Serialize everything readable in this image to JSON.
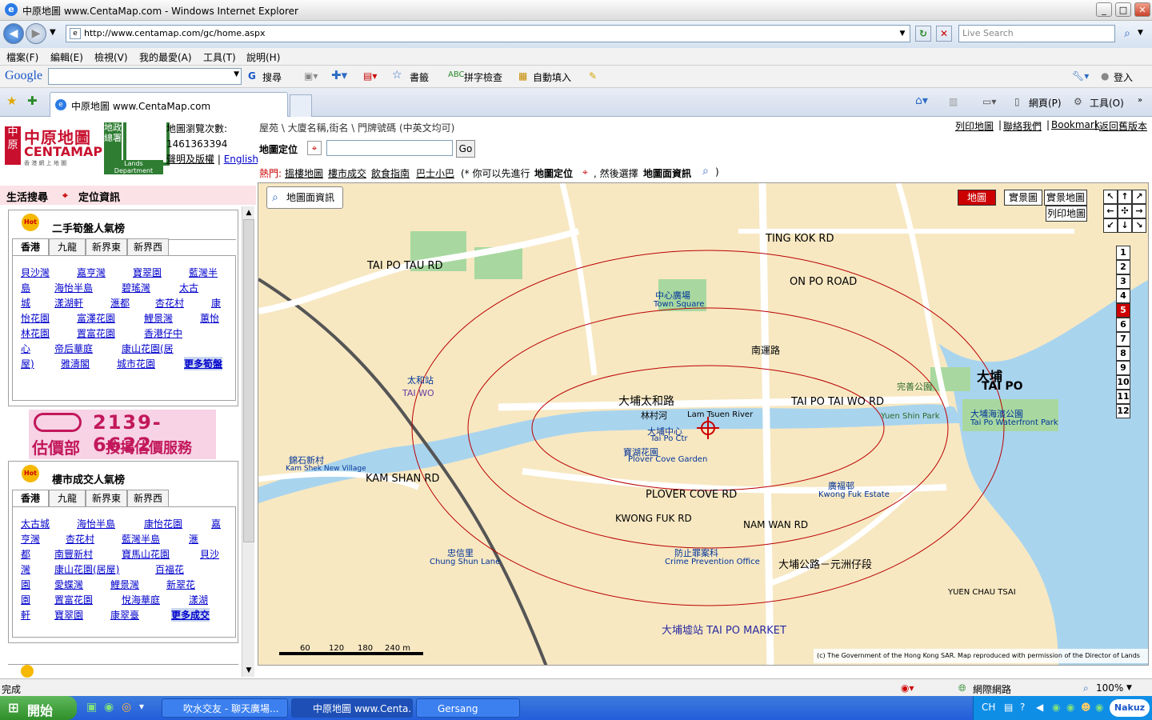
{
  "window": {
    "title": "中原地圖 www.CentaMap.com - Windows Internet Explorer",
    "icon": "ie-icon"
  },
  "addressbar": {
    "url": "http://www.centamap.com/gc/home.aspx",
    "search_placeholder": "Live Search"
  },
  "menu": [
    "檔案(F)",
    "編輯(E)",
    "檢視(V)",
    "我的最愛(A)",
    "工具(T)",
    "說明(H)"
  ],
  "google_toolbar": {
    "brand": "Google",
    "search_label": "搜尋",
    "bookmarks_label": "書籤",
    "spellcheck_label": "拼字檢查",
    "autofill_label": "自動填入",
    "signin_label": "登入"
  },
  "tab": {
    "title": "中原地圖 www.CentaMap.com",
    "page_menu": "網頁(P)",
    "tools_menu": "工具(O)"
  },
  "site": {
    "logo_cn_vertical": "中原",
    "logo_name": "中原地圖",
    "logo_en": "CENTAMAP",
    "logo_sub": "香 港 網 上 地 圖",
    "lands_dept_cn": "地政總署",
    "lands_dept_en": "Lands Department",
    "counter_label": "地圖瀏覽次數:",
    "counter_value": "1461363394",
    "disclaimer_link": "聲明及版權",
    "english_link": "English"
  },
  "left_header": {
    "tab1": "生活搜尋",
    "tab2": "定位資訊"
  },
  "section1": {
    "title": "二手筍盤人氣榜",
    "regions": [
      "香港",
      "九龍",
      "新界東",
      "新界西"
    ],
    "links": [
      "貝沙灣",
      "嘉亨灣",
      "寶翠園",
      "藍灣半",
      "島",
      "海怡半島",
      "碧瑤灣",
      "太古",
      "城",
      "漾湖軒",
      "滙都",
      "杏花村",
      "康",
      "怡花園",
      "富澤花園",
      "鯉景灣",
      "蕙怡",
      "林花園",
      "置富花園",
      "香港仔中",
      "心",
      "帝后華庭",
      "康山花園(居",
      "屋)",
      "雅濤閣",
      "城市花園"
    ],
    "more": "更多筍盤"
  },
  "banner": {
    "phone": "2139-6622",
    "dept": "估價部",
    "service": "按揭估價服務"
  },
  "section2": {
    "title": "樓市成交人氣榜",
    "regions": [
      "香港",
      "九龍",
      "新界東",
      "新界西"
    ],
    "links": [
      "太古城",
      "海怡半島",
      "康怡花園",
      "嘉",
      "亨灣",
      "杏花村",
      "藍灣半島",
      "滙",
      "都",
      "南豐新村",
      "寶馬山花園",
      "貝沙",
      "灣",
      "康山花園(居屋)",
      "百福花",
      "園",
      "愛蝶灣",
      "鯉景灣",
      "新翠花",
      "園",
      "置富花園",
      "悅海華庭",
      "漾湖",
      "軒",
      "寶翠園",
      "康翠臺"
    ],
    "more": "更多成交"
  },
  "map_header": {
    "hint": "屋苑 \\ 大廈名稱,街名 \\ 門牌號碼 (中英文均可)",
    "top_links": [
      "列印地圖",
      "聯絡我們",
      "Bookmark",
      "返回舊版本"
    ],
    "locate_label": "地圖定位",
    "go": "Go",
    "hot_label": "熱門:",
    "hot_links": [
      "搵樓地圖",
      "樓市成交",
      "飲食指南",
      "巴士小巴"
    ],
    "instruction_pre": "(* 你可以先進行",
    "instruction_locate": "地圖定位",
    "instruction_mid": ", 然後選擇",
    "instruction_info": "地圖面資訊",
    "instruction_post": ")"
  },
  "map": {
    "info_button": "地圖面資訊",
    "view_tabs": [
      "地圖",
      "實景圖",
      "實景地圖"
    ],
    "print_button": "列印地圖",
    "zoom_levels": [
      "1",
      "2",
      "3",
      "4",
      "5",
      "6",
      "7",
      "8",
      "9",
      "10",
      "11",
      "12"
    ],
    "zoom_selected": 5,
    "scale_labels": [
      "60",
      "120",
      "180",
      "240 m"
    ],
    "copyright": "(c) The Government of the Hong Kong SAR. Map reproduced with permission of the Director of Lands",
    "labels": [
      "大埔太和路",
      "TAI PO TAI WO RD",
      "林村河",
      "Lam Tsuen River",
      "大埔",
      "TAI PO",
      "大埔中心",
      "Tai Po Ctr",
      "寶湖花園",
      "Plover Cove Garden",
      "PLOVER COVE RD",
      "TAI PO TAU RD",
      "TING KOK RD",
      "ON PO ROAD",
      "KAM SHAN RD",
      "大埔海濱公園",
      "Tai Po Waterfront Park",
      "大埔墟站 TAI PO MARKET",
      "大埔公路－元洲仔段",
      "YUEN CHAU TSAI",
      "太和站",
      "TAI WO",
      "錦石新村",
      "Kam Shek New Village",
      "完善公園",
      "Yuen Shin Park",
      "中心廣場",
      "Town Square",
      "忠信里",
      "Chung Shun Lane",
      "南運路",
      "NAM WAN RD",
      "KWONG FUK RD",
      "防止罪案科",
      "Crime Prevention Office",
      "廣福邨",
      "Kwong Fuk Estate"
    ]
  },
  "statusbar": {
    "left": "完成",
    "zone": "網際網路",
    "zoom": "100%"
  },
  "taskbar": {
    "start": "開始",
    "tasks": [
      "吹水交友 - 聊天廣場...",
      "中原地圖 www.Centa...",
      "Gersang"
    ],
    "tray_lang": "CH",
    "tray_brand": "Nakuz"
  },
  "colors": {
    "accent_red": "#c8102e",
    "lands_green": "#2e7d32",
    "link_blue": "#0000cc",
    "map_base": "#f7e8c2",
    "water": "#a9d4ee",
    "park": "#a8d8a0"
  }
}
